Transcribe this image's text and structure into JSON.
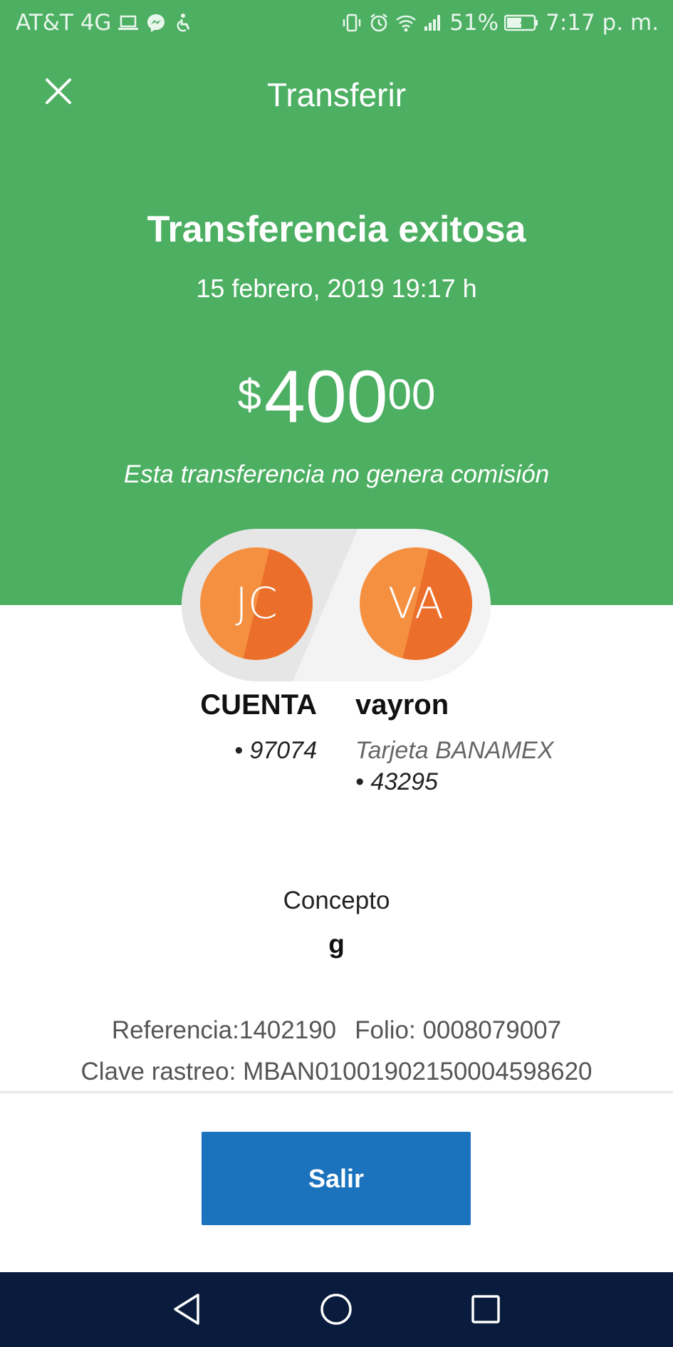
{
  "status_bar": {
    "carrier": "AT&T 4G",
    "battery": "51%",
    "time": "7:17 p. m."
  },
  "header": {
    "title": "Transferir",
    "success_title": "Transferencia exitosa",
    "date": "15 febrero, 2019 19:17 h",
    "amount": {
      "currency": "$",
      "integer": "400",
      "decimals": "00"
    },
    "fee_note": "Esta transferencia no genera comisión"
  },
  "transfer": {
    "from": {
      "initials": "JC",
      "name": "CUENTA",
      "account": "• 97074"
    },
    "to": {
      "initials": "VA",
      "name": "vayron",
      "account_type": "Tarjeta BANAMEX",
      "account": "• 43295"
    }
  },
  "details": {
    "concept_label": "Concepto",
    "concept_value": "g",
    "reference": "Referencia:1402190",
    "folio": "Folio: 0008079007",
    "tracking_key": "Clave rastreo: MBAN01001902150004598620"
  },
  "actions": {
    "exit_label": "Salir"
  },
  "colors": {
    "header_green": "#4caf62",
    "avatar_orange": "#f59041",
    "button_blue": "#1b72bd",
    "nav_navy": "#0a1c3e"
  }
}
